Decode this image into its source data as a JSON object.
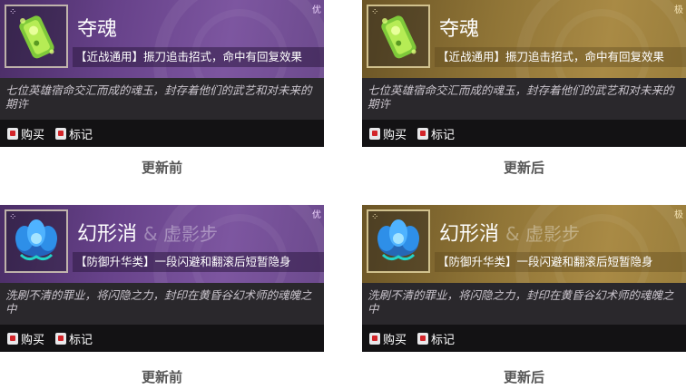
{
  "cards": [
    {
      "title": "夺魂",
      "subtitle": "",
      "badge": "⁘",
      "rarity": "优",
      "effect": "【近战通用】振刀追击招式，命中有回复效果",
      "description": "七位英雄宿命交汇而成的魂玉，封存着他们的武艺和对未来的期许",
      "buy": "购买",
      "mark": "标记",
      "caption": "更新前",
      "theme": "purple"
    },
    {
      "title": "夺魂",
      "subtitle": "",
      "badge": "⁘",
      "rarity": "极",
      "effect": "【近战通用】振刀追击招式，命中有回复效果",
      "description": "七位英雄宿命交汇而成的魂玉，封存着他们的武艺和对未来的期许",
      "buy": "购买",
      "mark": "标记",
      "caption": "更新后",
      "theme": "gold"
    },
    {
      "title": "幻形消",
      "subtitle": "& 虚影步",
      "badge": "⁘",
      "rarity": "优",
      "effect": "【防御升华类】一段闪避和翻滚后短暂隐身",
      "description": "洗刷不清的罪业，将闪隐之力，封印在黄昏谷幻术师的魂魄之中",
      "buy": "购买",
      "mark": "标记",
      "caption": "更新前",
      "theme": "purple"
    },
    {
      "title": "幻形消",
      "subtitle": "& 虚影步",
      "badge": "⁘",
      "rarity": "极",
      "effect": "【防御升华类】一段闪避和翻滚后短暂隐身",
      "description": "洗刷不清的罪业，将闪隐之力，封印在黄昏谷幻术师的魂魄之中",
      "buy": "购买",
      "mark": "标记",
      "caption": "更新后",
      "theme": "gold"
    }
  ],
  "icons": {
    "item_0": "green-jade-icon",
    "item_1": "blue-lotus-icon",
    "buy": "buy-icon",
    "mark": "mark-icon"
  }
}
